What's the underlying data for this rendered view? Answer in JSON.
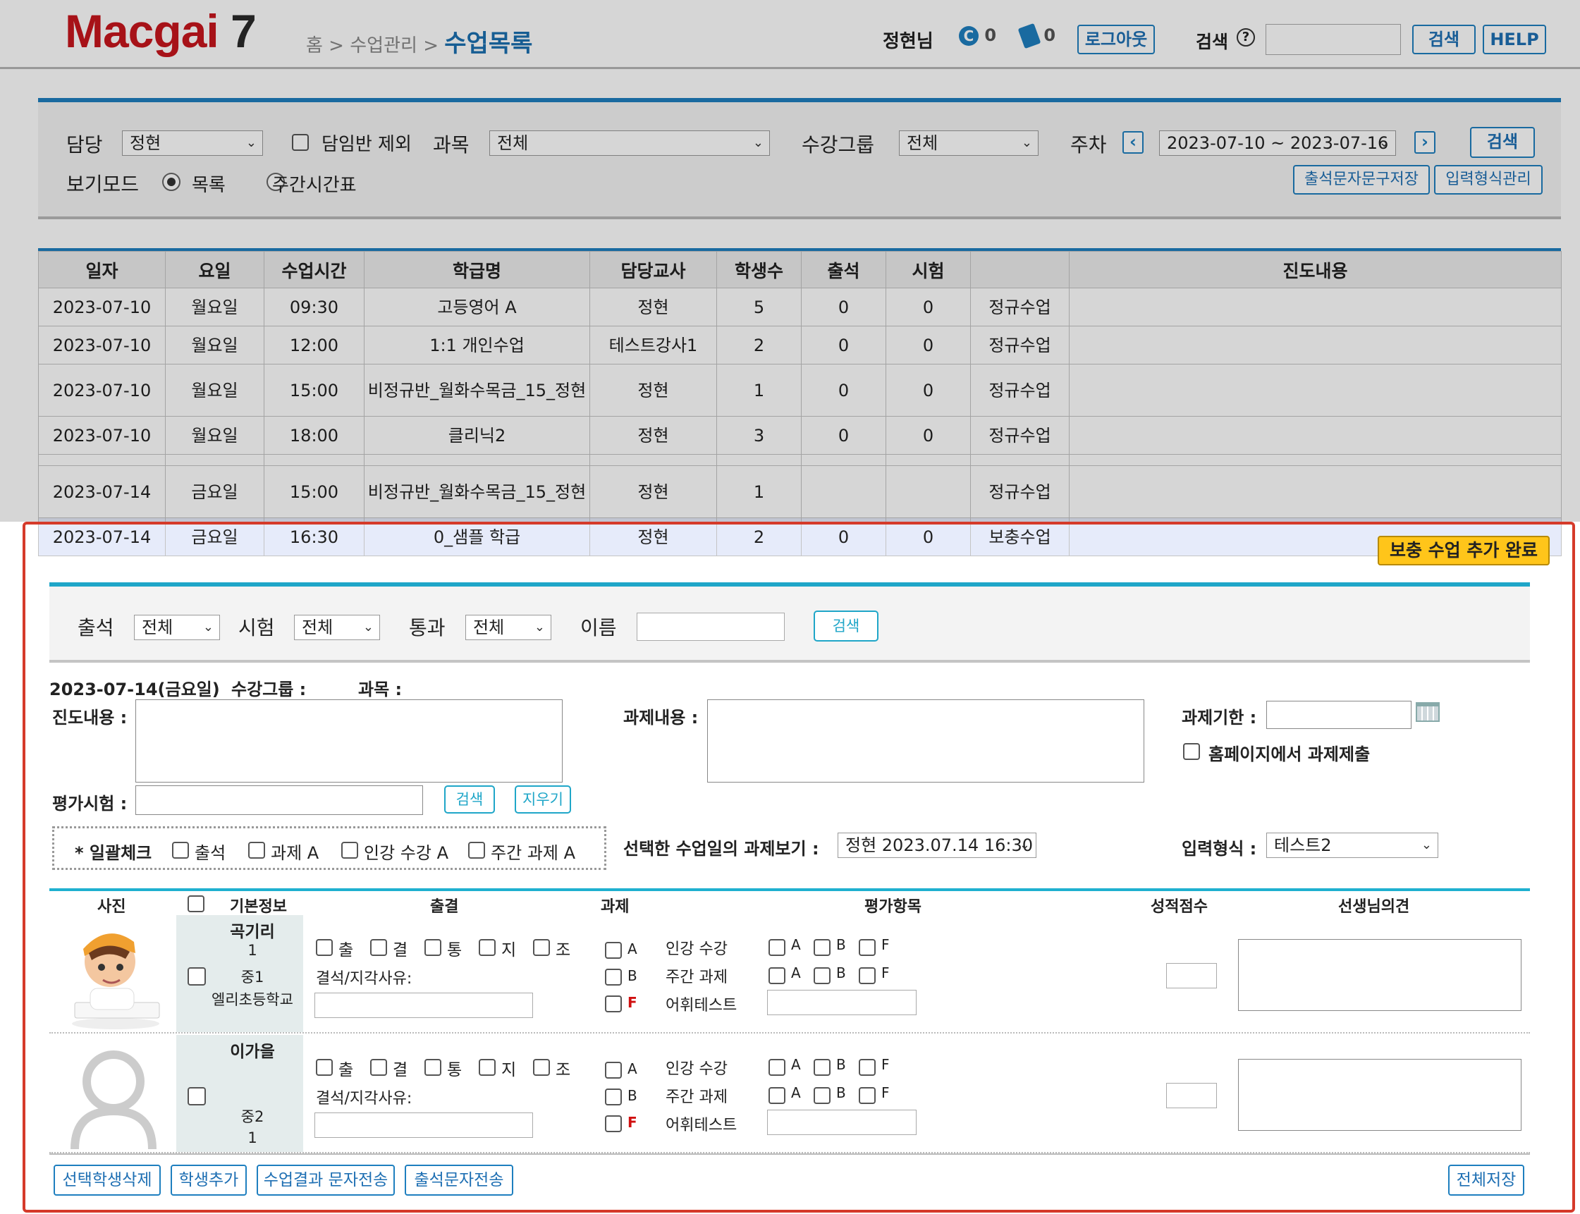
{
  "header": {
    "logo": "Macgai",
    "logo_num": "7",
    "crumb_home": "홈",
    "crumb_sep1": " > ",
    "crumb_mid": "수업관리",
    "crumb_sep2": " > ",
    "crumb_current": "수업목록",
    "user": "정현님",
    "count1": "0",
    "count2": "0",
    "logout": "로그아웃",
    "search_label": "검색",
    "search_btn": "검색",
    "help": "HELP"
  },
  "panel": {
    "teacher_label": "담당",
    "teacher_value": "정현",
    "exclude_label": "담임반 제외",
    "subject_label": "과목",
    "subject_value": "전체",
    "group_label": "수강그룹",
    "group_value": "전체",
    "week_label": "주차",
    "week_value": "2023-07-10 ~ 2023-07-16",
    "search_btn": "검색",
    "view_label": "보기모드",
    "view_list": "목록",
    "view_week": "주간시간표",
    "save_msg_btn": "출석문자문구저장",
    "format_btn": "입력형식관리"
  },
  "table": {
    "headers": [
      "일자",
      "요일",
      "수업시간",
      "학급명",
      "담당교사",
      "학생수",
      "출석",
      "시험",
      "",
      "진도내용"
    ],
    "rows": [
      [
        "2023-07-10",
        "월요일",
        "09:30",
        "고등영어 A",
        "정현",
        "5",
        "0",
        "0",
        "정규수업",
        ""
      ],
      [
        "2023-07-10",
        "월요일",
        "12:00",
        "1:1 개인수업",
        "테스트강사1",
        "2",
        "0",
        "0",
        "정규수업",
        ""
      ],
      [
        "2023-07-10",
        "월요일",
        "15:00",
        "비정규반_월화수목금_15_정현",
        "정현",
        "1",
        "0",
        "0",
        "정규수업",
        ""
      ],
      [
        "2023-07-10",
        "월요일",
        "18:00",
        "클리닉2",
        "정현",
        "3",
        "0",
        "0",
        "정규수업",
        ""
      ],
      [
        "",
        "",
        "",
        "",
        "",
        "",
        "",
        "",
        "",
        ""
      ],
      [
        "2023-07-14",
        "금요일",
        "15:00",
        "비정규반_월화수목금_15_정현",
        "정현",
        "1",
        "",
        "",
        "정규수업",
        ""
      ],
      [
        "2023-07-14",
        "금요일",
        "16:30",
        "0_샘플 학급",
        "정현",
        "2",
        "0",
        "0",
        "보충수업",
        ""
      ]
    ],
    "added_badge": "보충 수업 추가 완료"
  },
  "filter": {
    "attend_label": "출석",
    "attend_value": "전체",
    "exam_label": "시험",
    "exam_value": "전체",
    "pass_label": "통과",
    "pass_value": "전체",
    "name_label": "이름",
    "search_btn": "검색"
  },
  "form": {
    "date": "2023-07-14(금요일)",
    "group_label": "수강그룹 :",
    "subject_label": "과목 :",
    "progress_label": "진도내용 :",
    "hw_label": "과제내용 :",
    "deadline_label": "과제기한 :",
    "homepage_submit": "홈페이지에서 과제제출",
    "exam_label": "평가시험 :",
    "search_btn": "검색",
    "clear_btn": "지우기",
    "bulk_label": "* 일괄체크",
    "bulk_items": [
      "출석",
      "과제 A",
      "인강 수강 A",
      "주간 과제 A"
    ],
    "view_hw_label": "선택한 수업일의 과제보기 :",
    "view_hw_value": "정현 2023.07.14 16:30",
    "format_label": "입력형식 :",
    "format_value": "테스트2"
  },
  "grid": {
    "headers": {
      "photo": "사진",
      "info": "기본정보",
      "attend": "출결",
      "hw": "과제",
      "eval": "평가항목",
      "score": "성적점수",
      "comment": "선생님의견"
    },
    "attend_opts": [
      "출",
      "결",
      "통",
      "지",
      "조"
    ],
    "absent_reason": "결석/지각사유:",
    "hw_opts": [
      "A",
      "B",
      "F"
    ],
    "eval_items": [
      "인강 수강",
      "주간 과제",
      "어휘테스트"
    ],
    "grade_opts": [
      "A",
      "B",
      "F"
    ],
    "students": [
      {
        "name": "곡기리",
        "line1": "1",
        "line2": "중1",
        "line3": "엘리초등학교"
      },
      {
        "name": "이가을",
        "line1": "",
        "line2": "중2",
        "line3": "1"
      }
    ]
  },
  "bottom": {
    "delete": "선택학생삭제",
    "add": "학생추가",
    "result_sms": "수업결과 문자전송",
    "attend_sms": "출석문자전송",
    "save_all": "전체저장"
  },
  "colors": {
    "accent": "#1e7fbf",
    "teal": "#1fa6c8",
    "red_frame": "#d53a2a",
    "badge": "#ffc51a"
  }
}
